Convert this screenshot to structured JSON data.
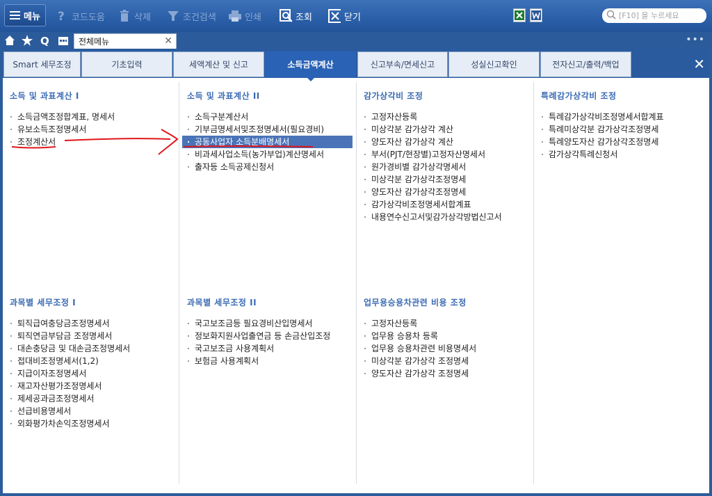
{
  "toolbar": {
    "menu_label": "메뉴",
    "items": [
      {
        "label": "코드도움",
        "icon": "help-icon",
        "enabled": false
      },
      {
        "label": "삭제",
        "icon": "trash-icon",
        "enabled": false
      },
      {
        "label": "조건검색",
        "icon": "filter-icon",
        "enabled": false
      },
      {
        "label": "인쇄",
        "icon": "printer-icon",
        "enabled": false
      },
      {
        "label": "조회",
        "icon": "search-doc-icon",
        "enabled": true
      },
      {
        "label": "닫기",
        "icon": "close-box-icon",
        "enabled": true
      }
    ],
    "search_placeholder": "[F10] 을 누르세요"
  },
  "navbar": {
    "doc_tab_label": "전체메뉴"
  },
  "main_tabs": [
    {
      "label": "Smart 세무조정",
      "active": false
    },
    {
      "label": "기초입력",
      "active": false
    },
    {
      "label": "세액계산 및 신고",
      "active": false
    },
    {
      "label": "소득금액계산",
      "active": true
    },
    {
      "label": "신고부속/면세신고",
      "active": false
    },
    {
      "label": "성실신고확인",
      "active": false
    },
    {
      "label": "전자신고/출력/백업",
      "active": false
    }
  ],
  "sections": [
    {
      "title": "소득 및 과표계산 I",
      "items": [
        "소득금액조정합계표, 명세서",
        "유보소득조정명세서",
        "조정계산서"
      ]
    },
    {
      "title": "소득 및 과표계산 II",
      "items": [
        "소득구분계산서",
        "기부금명세서및조정명세서(필요경비)",
        "공동사업자 소득분배명세서",
        "비과세사업소득(농가부업)계산명세서",
        "출자등 소득공제신청서"
      ]
    },
    {
      "title": "감가상각비 조정",
      "items": [
        "고정자산등록",
        "미상각분 감가상각 계산",
        "양도자산 감가상각 계산",
        "부서(PJT/현장별)고정자산명세서",
        "원가경비별 감가상각명세서",
        "미상각분 감가상각조정명세",
        "양도자산 감가상각조정명세",
        "감가상각비조정명세서합계표",
        "내용연수신고서및감가상각방법신고서"
      ]
    },
    {
      "title": "특례감가상각비 조정",
      "items": [
        "특례감가상각비조정명세서합계표",
        "특례미상각분 감가상각조정명세",
        "특례양도자산 감가상각조정명세",
        "감가상각특례신청서"
      ]
    },
    {
      "title": "과목별 세무조정 I",
      "items": [
        "퇴직급여충당금조정명세서",
        "퇴직연금부담금 조정명세서",
        "대손충당금 및 대손금조정명세서",
        "접대비조정명세서(1,2)",
        "지급이자조정명세서",
        "재고자산평가조정명세서",
        "제세공과금조정명세서",
        "선급비용명세서",
        "외화평가차손익조정명세서"
      ]
    },
    {
      "title": "과목별 세무조정 II",
      "items": [
        "국고보조금등 필요경비산입명세서",
        "정보화지원사업출연금 등 손금산입조정",
        "국고보조금 사용계획서",
        "보험금 사용계획서"
      ]
    },
    {
      "title": "업무용승용차관련 비용 조정",
      "items": [
        "고정자산등록",
        "업무용 승용차 등록",
        "업무용 승용차관련 비용명세서",
        "미상각분 감가상각 조정명세",
        "양도자산 감가상각 조정명세"
      ]
    }
  ],
  "colors": {
    "accent": "#2a62b5",
    "highlight_row": "#4b74b8",
    "section_title": "#3b6bb3",
    "annotation": "#e0161b"
  }
}
